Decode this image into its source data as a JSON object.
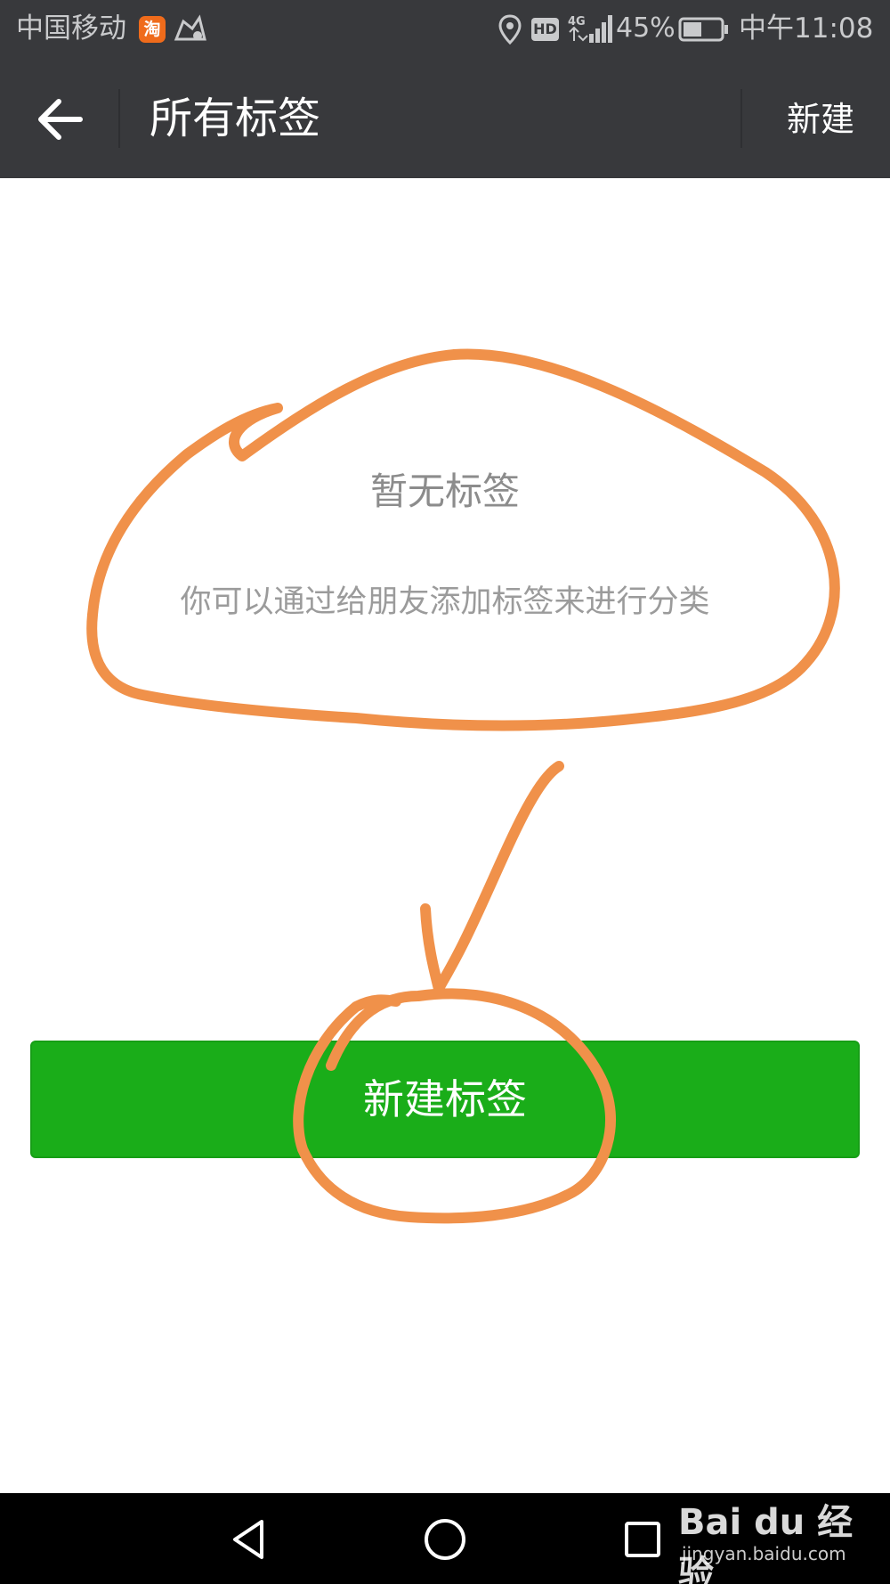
{
  "status_bar": {
    "carrier": "中国移动",
    "taobao_icon_glyph": "淘",
    "hd_label": "HD",
    "network": "4G",
    "battery_percent": "45%",
    "time": "中午11:08"
  },
  "action_bar": {
    "title": "所有标签",
    "new_label": "新建",
    "back_icon": "back-arrow-icon"
  },
  "empty_state": {
    "title": "暂无标签",
    "description": "你可以通过给朋友添加标签来进行分类"
  },
  "primary_button": {
    "label": "新建标签",
    "color": "#1aad19"
  },
  "nav_bar": {
    "icons": [
      "triangle-back-icon",
      "circle-home-icon",
      "square-recent-icon"
    ]
  },
  "watermark": {
    "logo": "Bai du 经验",
    "url": "jingyan.baidu.com"
  },
  "colors": {
    "header_bg": "#38393c",
    "annotation": "#f0914a",
    "button_green": "#1aad19"
  }
}
